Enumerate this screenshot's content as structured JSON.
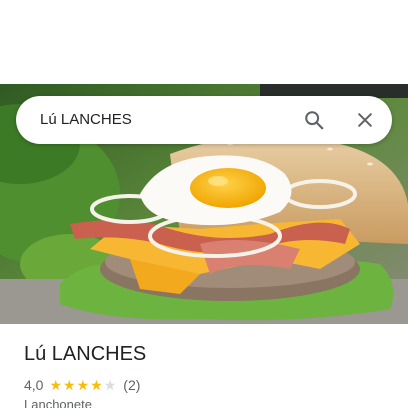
{
  "search": {
    "query": "Lú LANCHES"
  },
  "place": {
    "title": "Lú LANCHES",
    "rating": "4,0",
    "stars_filled": 4,
    "stars_total": 5,
    "review_count": "(2)",
    "category": "Lanchonete"
  },
  "icons": {
    "search": "search-icon",
    "close": "close-icon",
    "star": "star-icon"
  },
  "colors": {
    "star_filled": "#fbbc04",
    "star_empty": "#dadce0",
    "icon": "#5f6368",
    "text_primary": "#202124",
    "text_secondary": "#5f6368"
  }
}
